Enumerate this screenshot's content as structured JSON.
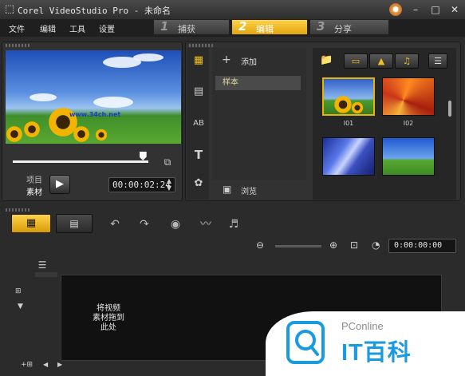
{
  "window": {
    "title": "Corel VideoStudio Pro - 未命名"
  },
  "menu": [
    "文件",
    "编辑",
    "工具",
    "设置"
  ],
  "steps": [
    {
      "num": "1",
      "label": "捕获",
      "active": false
    },
    {
      "num": "2",
      "label": "编辑",
      "active": true
    },
    {
      "num": "3",
      "label": "分享",
      "active": false
    }
  ],
  "preview": {
    "watermark_text": "www.34ch.net",
    "mode_project": "项目",
    "mode_clip": "素材",
    "timecode": "00:00:02:24",
    "scrub_fraction": 0.96
  },
  "library": {
    "add_label": "添加",
    "selected_folder": "样本",
    "browse_label": "浏览",
    "thumbnails": [
      "I01",
      "I02",
      "",
      ""
    ]
  },
  "timeline": {
    "timecode": "0:00:00:00",
    "drop_hint": "将视频\n素材拖到\n此处"
  },
  "watermark": {
    "site": "PConline",
    "brand": "IT百科"
  }
}
